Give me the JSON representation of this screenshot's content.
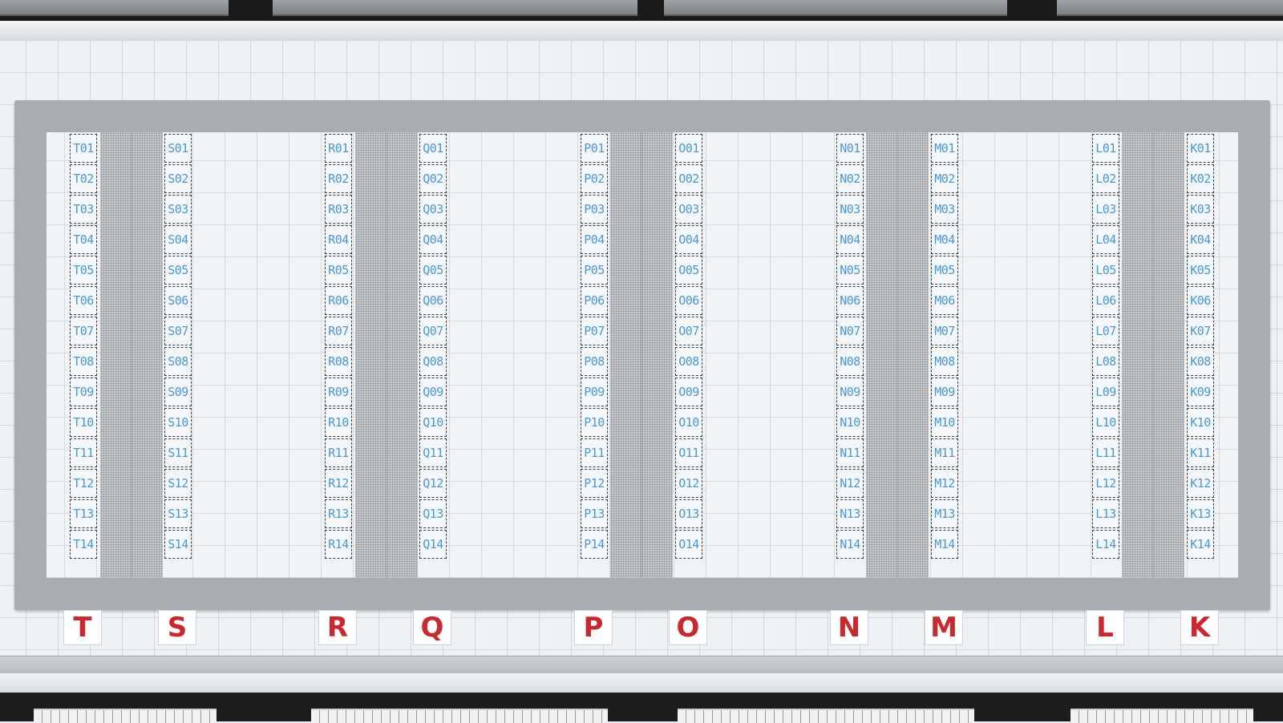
{
  "colors": {
    "slot_text": "#4a96d6",
    "row_label_text": "#c8282e",
    "frame": "#a9adb2",
    "floor": "#eef2f6"
  },
  "columns": [
    {
      "letter": "T",
      "slots": [
        "T01",
        "T02",
        "T03",
        "T04",
        "T05",
        "T06",
        "T07",
        "T08",
        "T09",
        "T10",
        "T11",
        "T12",
        "T13",
        "T14"
      ]
    },
    {
      "letter": "S",
      "slots": [
        "S01",
        "S02",
        "S03",
        "S04",
        "S05",
        "S06",
        "S07",
        "S08",
        "S09",
        "S10",
        "S11",
        "S12",
        "S13",
        "S14"
      ]
    },
    {
      "letter": "R",
      "slots": [
        "R01",
        "R02",
        "R03",
        "R04",
        "R05",
        "R06",
        "R07",
        "R08",
        "R09",
        "R10",
        "R11",
        "R12",
        "R13",
        "R14"
      ]
    },
    {
      "letter": "Q",
      "slots": [
        "Q01",
        "Q02",
        "Q03",
        "Q04",
        "Q05",
        "Q06",
        "Q07",
        "Q08",
        "Q09",
        "Q10",
        "Q11",
        "Q12",
        "Q13",
        "Q14"
      ]
    },
    {
      "letter": "P",
      "slots": [
        "P01",
        "P02",
        "P03",
        "P04",
        "P05",
        "P06",
        "P07",
        "P08",
        "P09",
        "P10",
        "P11",
        "P12",
        "P13",
        "P14"
      ]
    },
    {
      "letter": "O",
      "slots": [
        "O01",
        "O02",
        "O03",
        "O04",
        "O05",
        "O06",
        "O07",
        "O08",
        "O09",
        "O10",
        "O11",
        "O12",
        "O13",
        "O14"
      ]
    },
    {
      "letter": "N",
      "slots": [
        "N01",
        "N02",
        "N03",
        "N04",
        "N05",
        "N06",
        "N07",
        "N08",
        "N09",
        "N10",
        "N11",
        "N12",
        "N13",
        "N14"
      ]
    },
    {
      "letter": "M",
      "slots": [
        "M01",
        "M02",
        "M03",
        "M04",
        "M05",
        "M06",
        "M07",
        "M08",
        "M09",
        "M10",
        "M11",
        "M12",
        "M13",
        "M14"
      ]
    },
    {
      "letter": "L",
      "slots": [
        "L01",
        "L02",
        "L03",
        "L04",
        "L05",
        "L06",
        "L07",
        "L08",
        "L09",
        "L10",
        "L11",
        "L12",
        "L13",
        "L14"
      ]
    },
    {
      "letter": "K",
      "slots": [
        "K01",
        "K02",
        "K03",
        "K04",
        "K05",
        "K06",
        "K07",
        "K08",
        "K09",
        "K10",
        "K11",
        "K12",
        "K13",
        "K14"
      ]
    }
  ]
}
